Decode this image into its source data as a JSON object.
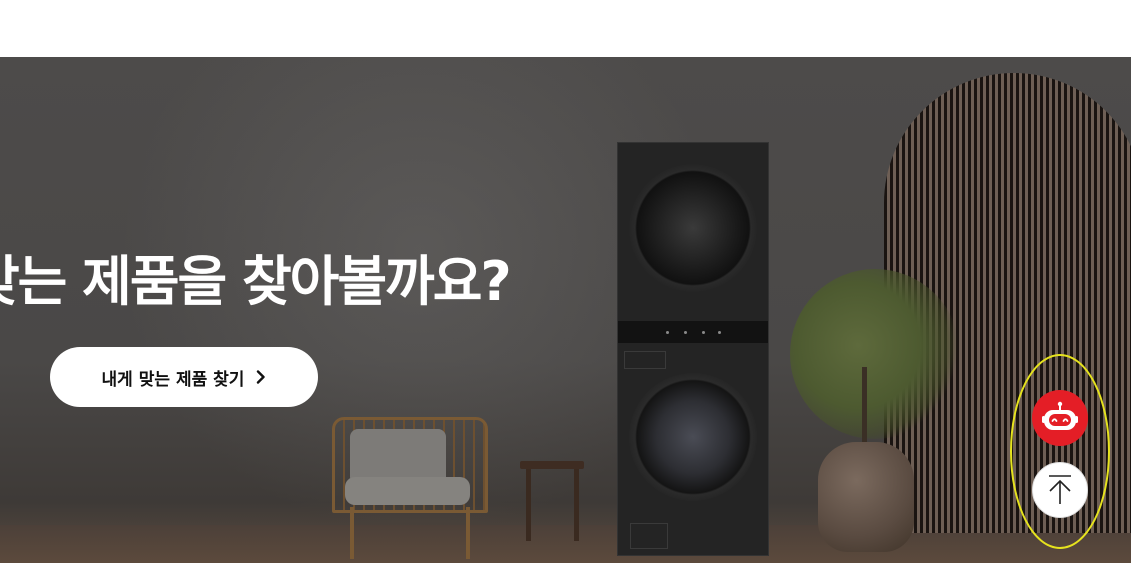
{
  "hero": {
    "title": "맞는 제품을 찾아볼까요?",
    "cta_label": "내게 맞는 제품 찾기"
  },
  "icons": {
    "cta": "chevron-right-icon",
    "chatbot": "robot-icon",
    "top": "arrow-up-icon"
  },
  "colors": {
    "chatbot_button": "#e41e26",
    "highlight_outline": "#e6e31e",
    "cta_background": "#ffffff"
  }
}
